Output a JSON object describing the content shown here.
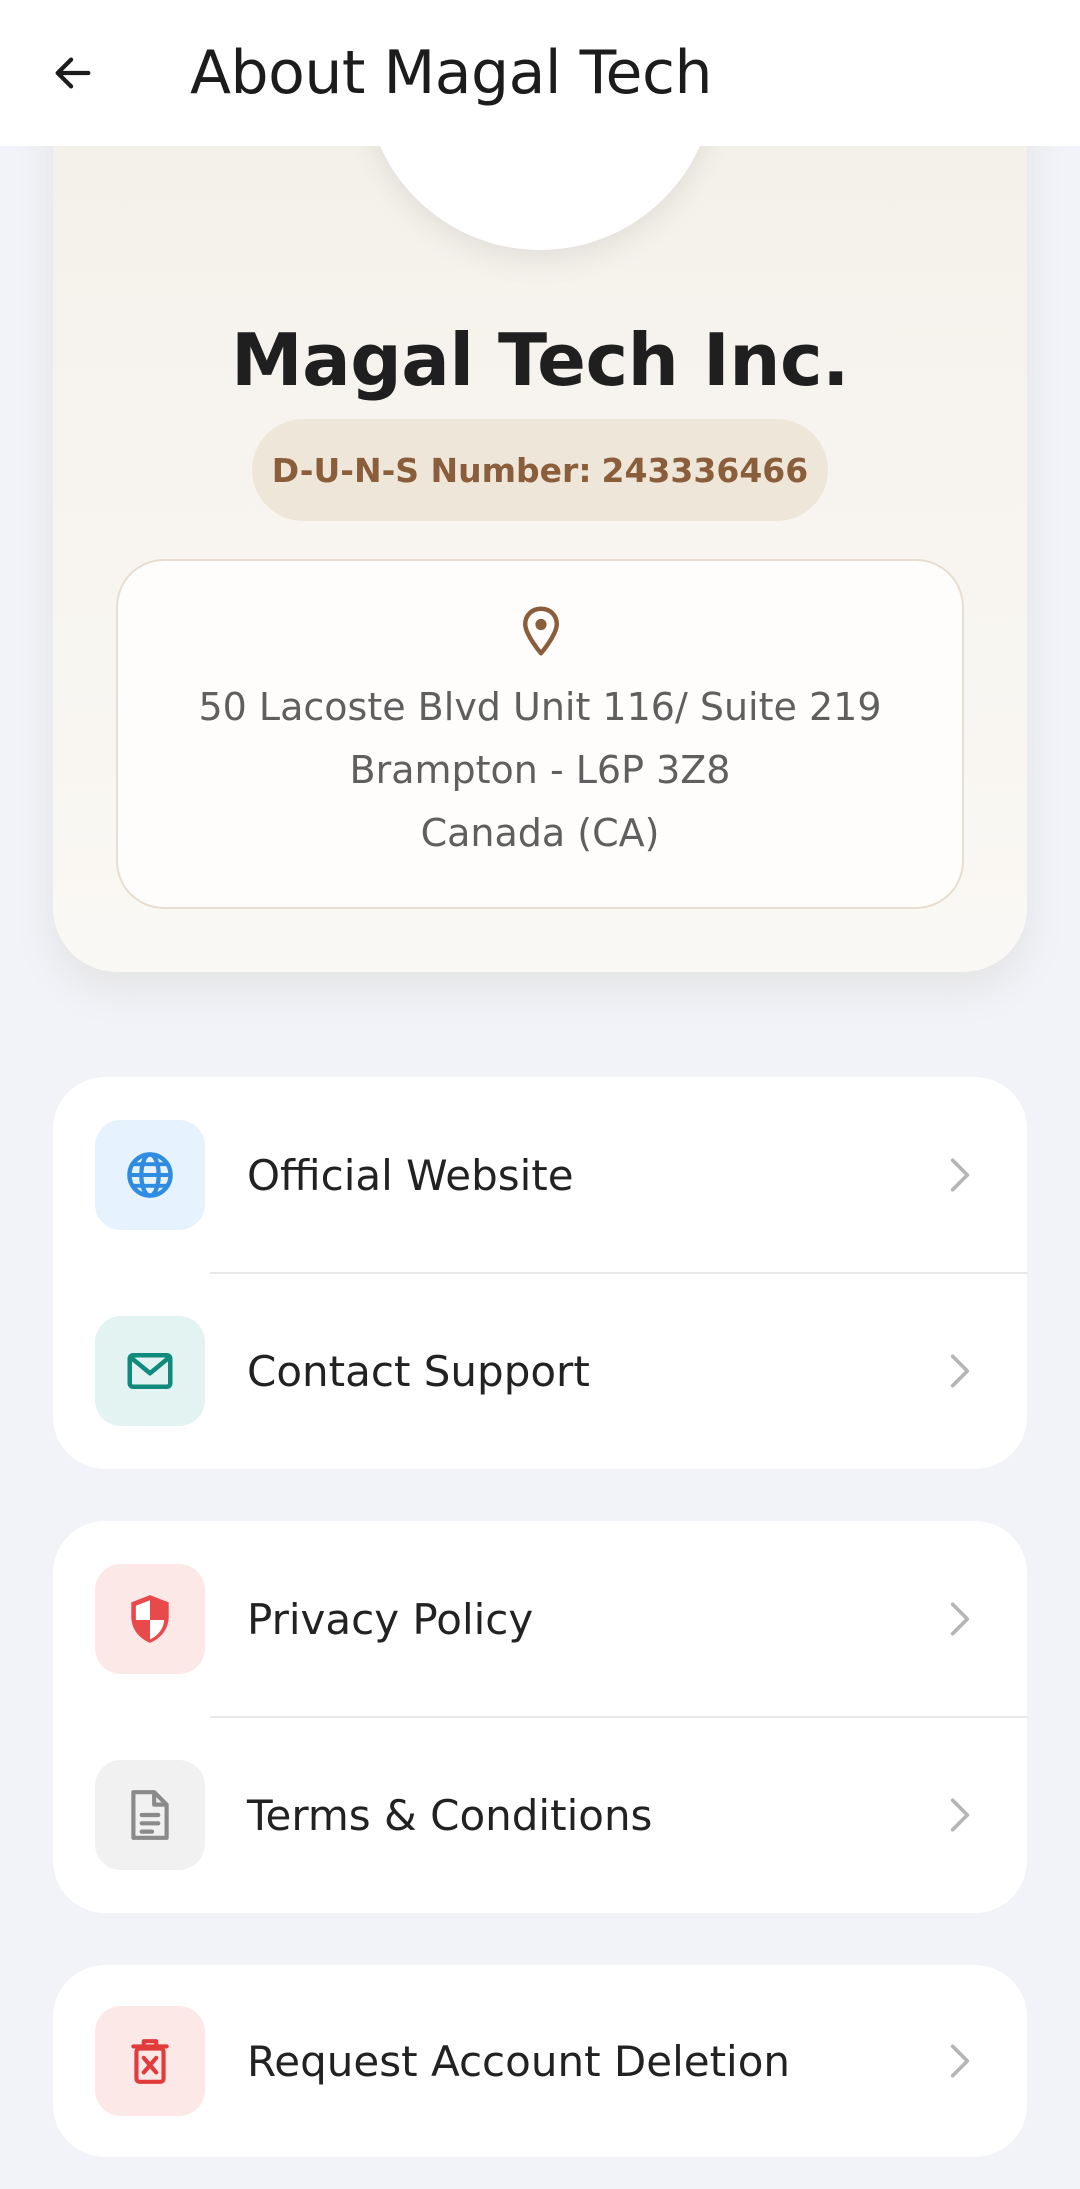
{
  "app_bar": {
    "title": "About Magal Tech",
    "back_icon": "arrow-left-icon"
  },
  "company": {
    "name": "Magal Tech Inc.",
    "duns_label": "D-U-N-S Number:",
    "duns_value": "243336466",
    "address": {
      "line1": "50 Lacoste Blvd Unit 116/ Suite 219",
      "line2": "Brampton - L6P 3Z8",
      "line3": "Canada (CA)"
    }
  },
  "menu_group_1": {
    "items": [
      {
        "label": "Official Website",
        "icon": "globe-icon",
        "tile_color": "#e6f2fd",
        "icon_color": "#2f8ce0"
      },
      {
        "label": "Contact Support",
        "icon": "mail-icon",
        "tile_color": "#e3f3f1",
        "icon_color": "#0f8a7c"
      }
    ]
  },
  "menu_group_2": {
    "items": [
      {
        "label": "Privacy Policy",
        "icon": "shield-icon",
        "tile_color": "#fde8e8",
        "icon_color": "#e8494a"
      },
      {
        "label": "Terms & Conditions",
        "icon": "document-icon",
        "tile_color": "#f1f1f1",
        "icon_color": "#8a8a8a"
      }
    ]
  },
  "menu_group_3": {
    "items": [
      {
        "label": "Request Account Deletion",
        "icon": "trash-icon",
        "tile_color": "#fde8e8",
        "icon_color": "#e23b3b"
      }
    ]
  },
  "colors": {
    "background": "#f1f3f8",
    "accent_brown": "#8a5e3b",
    "badge_bg": "#efe6da"
  }
}
